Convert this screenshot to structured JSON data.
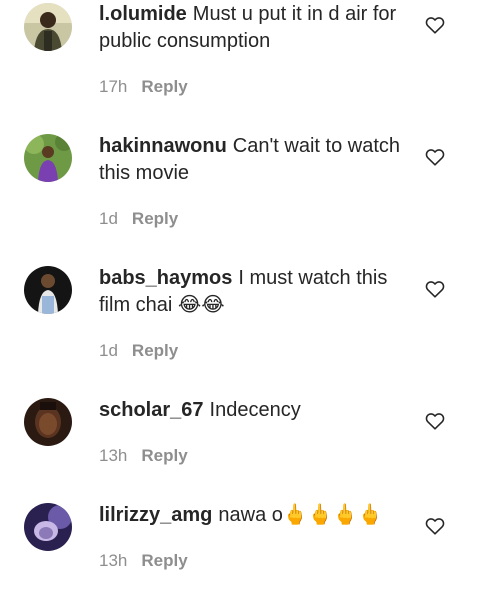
{
  "comments": [
    {
      "username": "l.olumide",
      "text": "Must u put it in d air for public consumption",
      "time": "17h",
      "reply_label": "Reply"
    },
    {
      "username": "hakinnawonu",
      "text": "Can't wait to watch this movie",
      "time": "1d",
      "reply_label": "Reply"
    },
    {
      "username": "babs_haymos",
      "text": "I must watch this film chai 😂😂",
      "time": "1d",
      "reply_label": "Reply"
    },
    {
      "username": "scholar_67",
      "text": "Indecency",
      "time": "13h",
      "reply_label": "Reply"
    },
    {
      "username": "lilrizzy_amg",
      "text": "nawa o🖕🖕🖕🖕",
      "time": "13h",
      "reply_label": "Reply"
    }
  ],
  "icons": {
    "like": "heart-outline-icon"
  },
  "colors": {
    "text": "#262626",
    "secondary": "#8e8e8e",
    "background": "#ffffff"
  }
}
